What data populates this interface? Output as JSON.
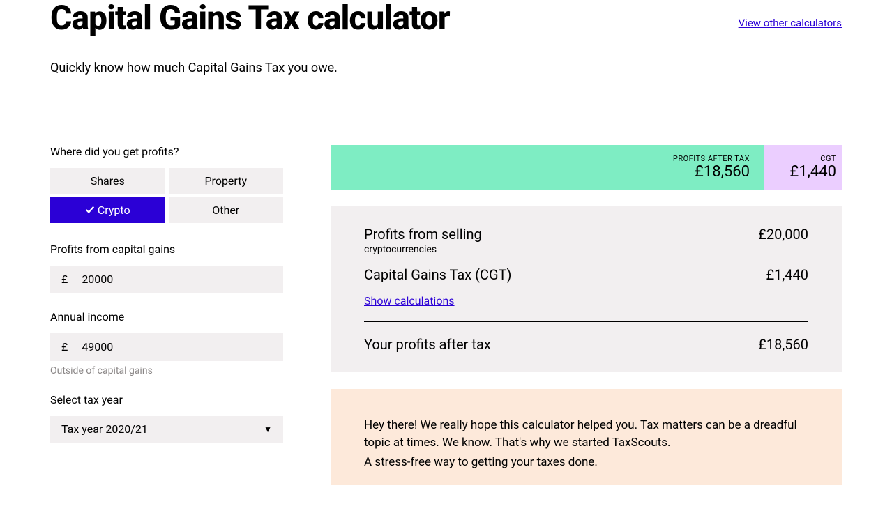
{
  "header": {
    "title": "Capital Gains Tax calculator",
    "other_link": "View other calculators",
    "subtitle": "Quickly know how much Capital Gains Tax you owe."
  },
  "form": {
    "profits_source_label": "Where did you get profits?",
    "options": {
      "shares": "Shares",
      "property": "Property",
      "crypto": "Crypto",
      "other": "Other"
    },
    "selected_option": "crypto",
    "profits_label": "Profits from capital gains",
    "profits_value": "20000",
    "income_label": "Annual income",
    "income_value": "49000",
    "income_helper": "Outside of capital gains",
    "tax_year_label": "Select tax year",
    "tax_year_value": "Tax year 2020/21",
    "currency_prefix": "£"
  },
  "results": {
    "bar_profits_label": "PROFITS AFTER TAX",
    "bar_profits_value": "£18,560",
    "bar_cgt_label": "CGT",
    "bar_cgt_value": "£1,440",
    "row_selling_label": "Profits from selling",
    "row_selling_sub": "cryptocurrencies",
    "row_selling_value": "£20,000",
    "row_cgt_label": "Capital Gains Tax (CGT)",
    "row_cgt_value": "£1,440",
    "show_calc": "Show calculations",
    "row_after_label": "Your profits after tax",
    "row_after_value": "£18,560"
  },
  "promo": {
    "line1": "Hey there! We really hope this calculator helped you. Tax matters can be a dreadful topic at times. We know. That's why we started TaxScouts.",
    "line2": "A stress-free way to getting your taxes done."
  }
}
